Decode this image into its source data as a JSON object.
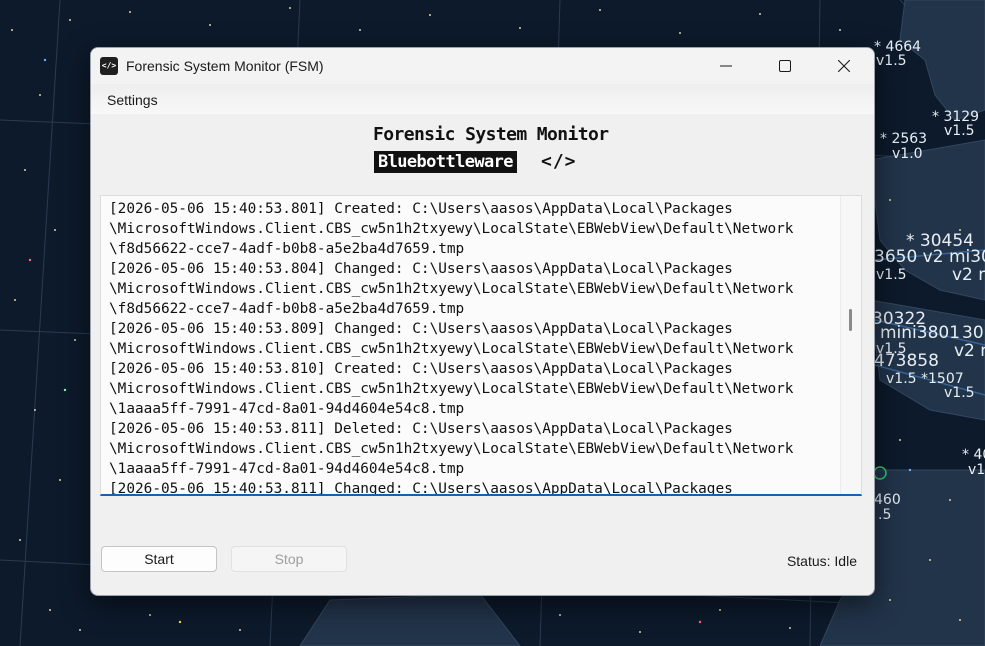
{
  "window": {
    "title": "Forensic System Monitor (FSM)",
    "icon": "code-icon"
  },
  "menu": {
    "settings": "Settings"
  },
  "banner": {
    "title": "Forensic System Monitor",
    "brand": "Bluebottleware",
    "code_symbol": "</>"
  },
  "log": {
    "lines": [
      "[2026-05-06 15:40:53.801] Created: C:\\Users\\aasos\\AppData\\Local\\Packages",
      "\\MicrosoftWindows.Client.CBS_cw5n1h2txyewy\\LocalState\\EBWebView\\Default\\Network",
      "\\f8d56622-cce7-4adf-b0b8-a5e2ba4d7659.tmp",
      "[2026-05-06 15:40:53.804] Changed: C:\\Users\\aasos\\AppData\\Local\\Packages",
      "\\MicrosoftWindows.Client.CBS_cw5n1h2txyewy\\LocalState\\EBWebView\\Default\\Network",
      "\\f8d56622-cce7-4adf-b0b8-a5e2ba4d7659.tmp",
      "[2026-05-06 15:40:53.809] Changed: C:\\Users\\aasos\\AppData\\Local\\Packages",
      "\\MicrosoftWindows.Client.CBS_cw5n1h2txyewy\\LocalState\\EBWebView\\Default\\Network",
      "[2026-05-06 15:40:53.810] Created: C:\\Users\\aasos\\AppData\\Local\\Packages",
      "\\MicrosoftWindows.Client.CBS_cw5n1h2txyewy\\LocalState\\EBWebView\\Default\\Network",
      "\\1aaaa5ff-7991-47cd-8a01-94d4604e54c8.tmp",
      "[2026-05-06 15:40:53.811] Deleted: C:\\Users\\aasos\\AppData\\Local\\Packages",
      "\\MicrosoftWindows.Client.CBS_cw5n1h2txyewy\\LocalState\\EBWebView\\Default\\Network",
      "\\1aaaa5ff-7991-47cd-8a01-94d4604e54c8.tmp",
      "[2026-05-06 15:40:53.811] Changed: C:\\Users\\aasos\\AppData\\Local\\Packages"
    ]
  },
  "controls": {
    "start": "Start",
    "stop": "Stop",
    "stop_enabled": false
  },
  "status": "Status: Idle",
  "background_labels": [
    "* 4664",
    "v1.5",
    "* 3129",
    "v1.5",
    "* 2563",
    "v1.0",
    "* 30454",
    "3650 v2 mi301",
    "v1.5",
    "v2 m",
    "30322",
    "mini3801",
    "30",
    "473858",
    "v1.5",
    "v2 n",
    "v1.5 *1507",
    "v1.5",
    "* 40",
    "v1",
    "460",
    ".5"
  ],
  "colors": {
    "desktop": "#0d1a2b",
    "land": "#22344a",
    "accent": "#1a5fb4",
    "window_bg": "#f0f0f0"
  }
}
